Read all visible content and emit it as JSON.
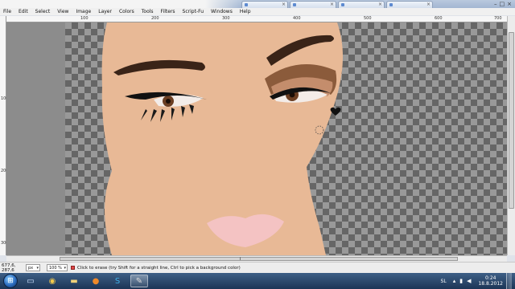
{
  "menu": [
    "File",
    "Edit",
    "Select",
    "View",
    "Image",
    "Layer",
    "Colors",
    "Tools",
    "Filters",
    "Script-Fu",
    "Windows",
    "Help"
  ],
  "browser_tabs": [
    "",
    "",
    "",
    ""
  ],
  "ruler": {
    "h_labels": [
      "100",
      "200",
      "300",
      "400",
      "500",
      "600",
      "700"
    ],
    "v_labels": [
      "100",
      "200",
      "300"
    ]
  },
  "status": {
    "coords": "677,6, 287,6",
    "unit": "px",
    "zoom": "100 %",
    "message": "Click to erase (try Shift for a straight line, Ctrl to pick a background color)"
  },
  "taskbar": {
    "apps": [
      "windows-explorer",
      "chrome",
      "folder",
      "firefox",
      "skype",
      "gimp"
    ],
    "lang": "SL",
    "time": "0:24",
    "date": "18.8.2012"
  },
  "colors": {
    "skin": "#e8b996",
    "lips": "#f4c3c3",
    "brow": "#3a2418"
  }
}
